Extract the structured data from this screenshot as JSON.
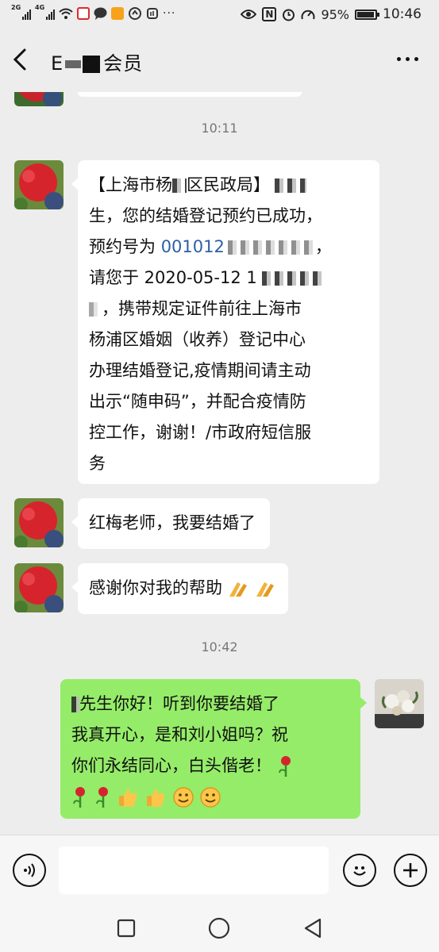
{
  "status_bar": {
    "signal1_tag": "2G",
    "signal2_tag": "4G",
    "battery": "95%",
    "battery_level": 0.95,
    "time": "10:46",
    "nfc_label": "N"
  },
  "header": {
    "title_prefix": "E",
    "title_suffix": "会员"
  },
  "messages": {
    "time1": "10:11",
    "msg1": {
      "line1_a": "【上海市杨",
      "line1_b": "区民政局】",
      "line1_c": "",
      "line2": "生，您的结婚登记预约已成功，",
      "line3_a": "预约号为",
      "line3_num": "001012",
      "line3_end": "，",
      "line4": "请您于 2020-05-12 1",
      "line5": "，携带规定证件前往上海市",
      "line6": "杨浦区婚姻（收养）登记中心",
      "line7": "办理结婚登记,疫情期间请主动",
      "line8": "出示“随申码”，并配合疫情防",
      "line9": "控工作，谢谢！/市政府短信服",
      "line10": "务"
    },
    "msg2": "红梅老师，我要结婚了",
    "msg3": "感谢你对我的帮助",
    "time2": "10:42",
    "msg4": {
      "line1": "先生你好！听到你要结婚了",
      "line2": "我真开心，是和刘小姐吗？祝",
      "line3": "你们永结同心，白头偕老！"
    }
  },
  "input": {
    "placeholder": ""
  },
  "icons": {
    "voice": "voice-icon",
    "emoji": "emoji-icon",
    "plus": "plus-icon",
    "back": "back-arrow-icon",
    "more": "more-icon"
  },
  "colors": {
    "bubble_sent": "#95ec69",
    "bubble_received": "#ffffff",
    "background": "#ededed",
    "number_link": "#2d5fa6"
  }
}
